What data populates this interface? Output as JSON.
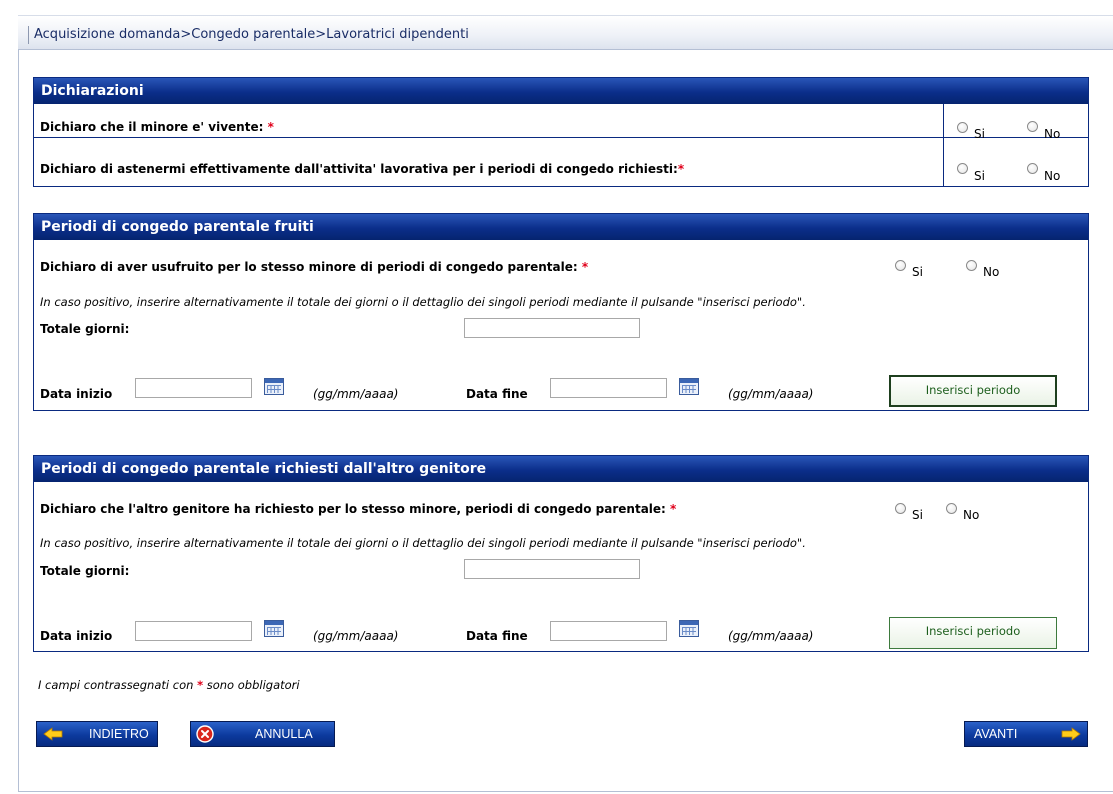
{
  "breadcrumb": "Acquisizione domanda>Congedo parentale>Lavoratrici dipendenti",
  "radio_si": "Si",
  "radio_no": "No",
  "required_mark": "*",
  "date_format_hint": "(gg/mm/aaaa)",
  "dichiarazioni": {
    "title": "Dichiarazioni",
    "q1": "Dichiaro che il minore e' vivente:",
    "q2": "Dichiaro di astenermi effettivamente dall'attivita' lavorativa per i periodi di congedo richiesti:"
  },
  "fruiti": {
    "title": "Periodi di congedo parentale fruiti",
    "question": "Dichiaro di aver usufruito per lo stesso minore di periodi di congedo parentale:",
    "note": "In caso positivo, inserire alternativamente il totale dei giorni o il dettaglio dei singoli periodi mediante il pulsande \"inserisci periodo\".",
    "totale_label": "Totale giorni:",
    "data_inizio_label": "Data inizio",
    "data_fine_label": "Data fine",
    "insert_button": "Inserisci periodo"
  },
  "altro": {
    "title": "Periodi di congedo parentale richiesti dall'altro genitore",
    "question": "Dichiaro che l'altro genitore ha richiesto per lo stesso minore, periodi di congedo parentale:",
    "note": "In caso positivo, inserire alternativamente il totale dei giorni o il dettaglio dei singoli periodi mediante il pulsande \"inserisci periodo\".",
    "totale_label": "Totale giorni:",
    "data_inizio_label": "Data inizio",
    "data_fine_label": "Data fine",
    "insert_button": "Inserisci periodo"
  },
  "footnote_before": "I campi contrassegnati con",
  "footnote_after": "sono obbligatori",
  "buttons": {
    "back": "INDIETRO",
    "cancel": "ANNULLA",
    "next": "AVANTI"
  },
  "colors": {
    "header_blue": "#0b2e8a",
    "required_red": "#e0001a",
    "insert_green": "#1c5e1c"
  }
}
